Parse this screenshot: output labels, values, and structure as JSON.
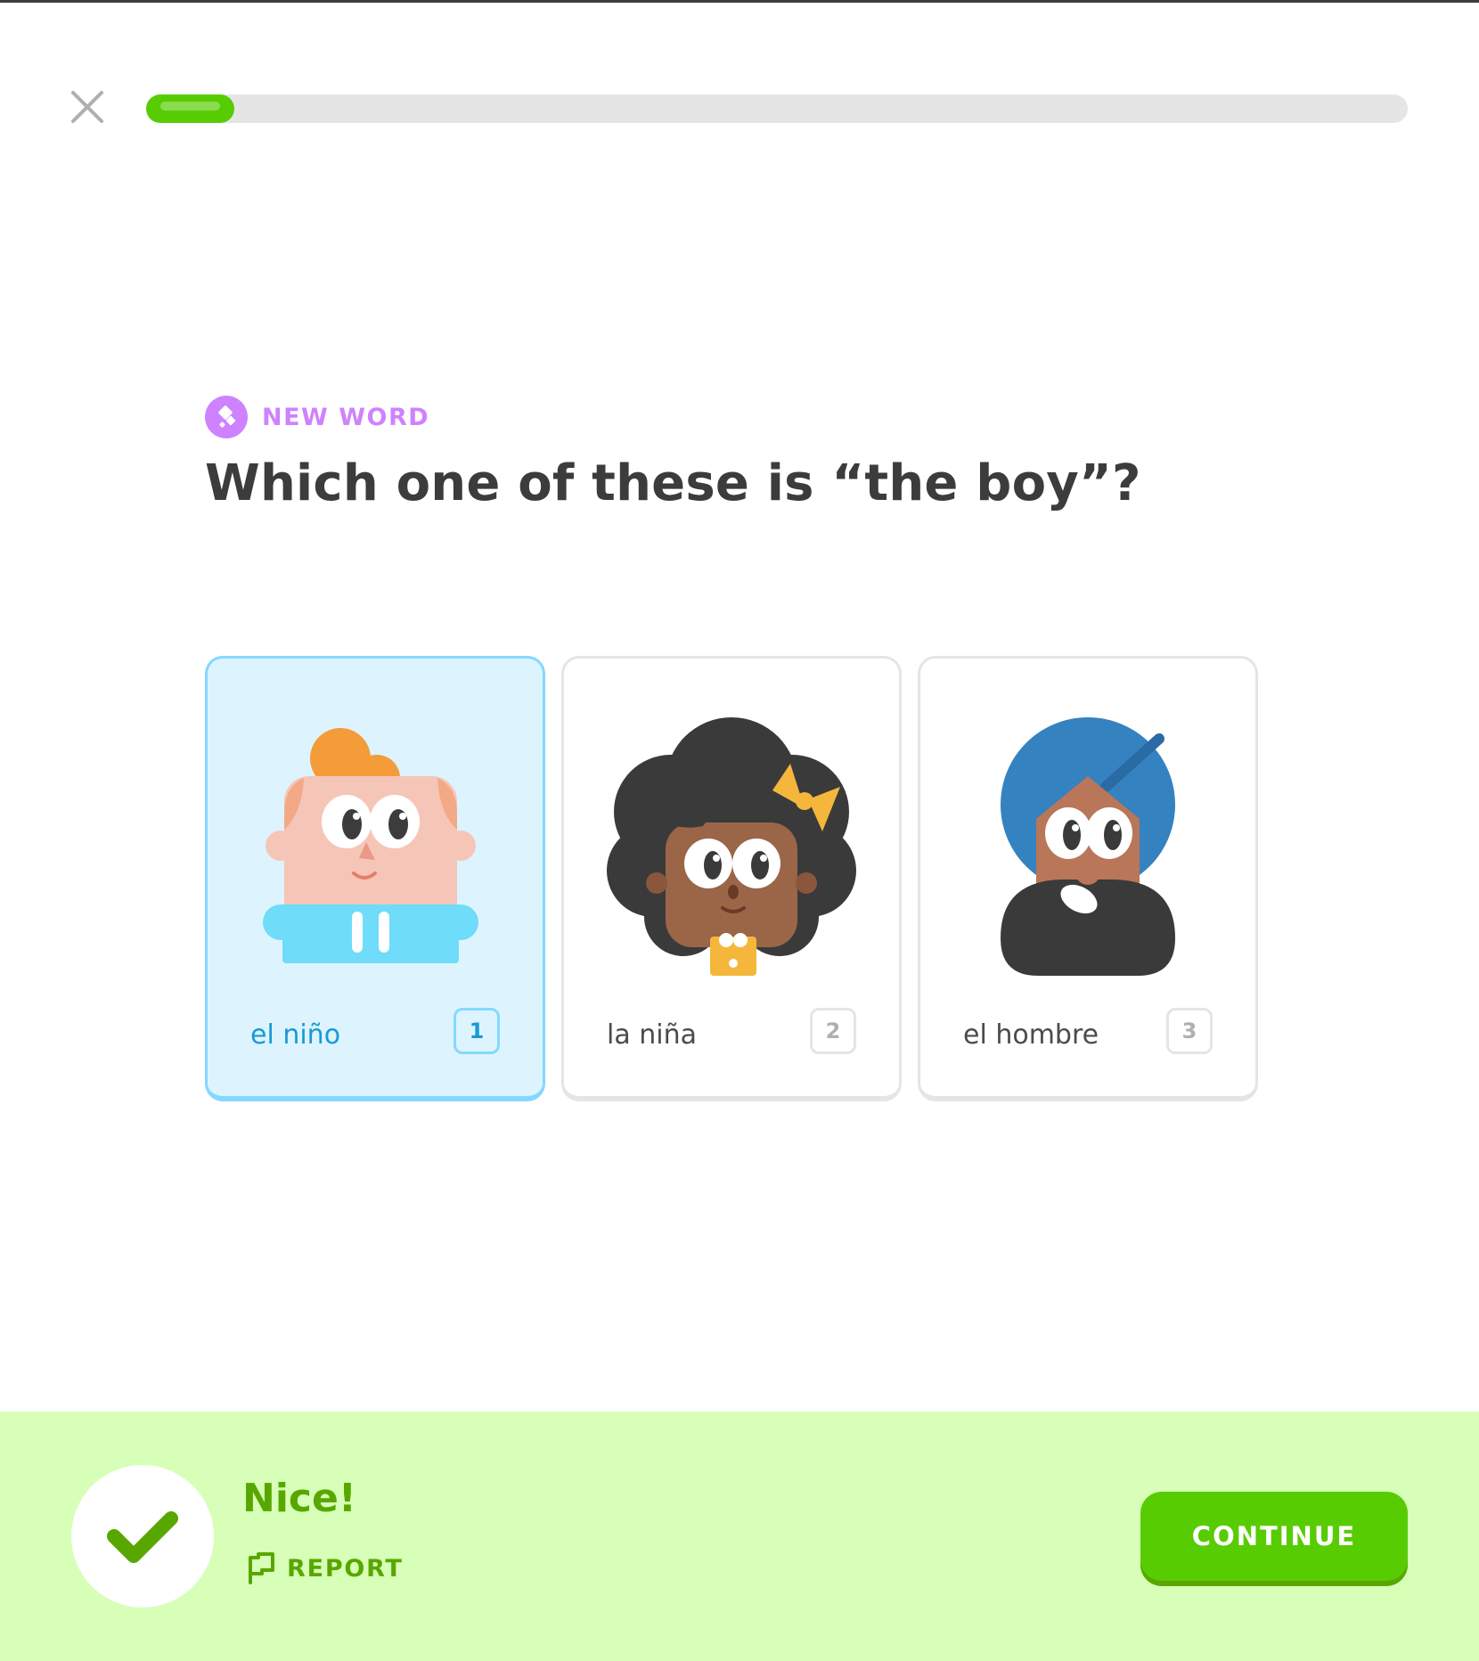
{
  "header": {
    "close_icon": "close-icon",
    "progress": 0.07
  },
  "challenge": {
    "badge_icon": "new-word-icon",
    "badge_label": "NEW WORD",
    "question": "Which one of these is “the boy”?"
  },
  "choices": [
    {
      "label": "el niño",
      "key": "1",
      "selected": true,
      "art": "boy-character"
    },
    {
      "label": "la niña",
      "key": "2",
      "selected": false,
      "art": "girl-character"
    },
    {
      "label": "el hombre",
      "key": "3",
      "selected": false,
      "art": "man-character"
    }
  ],
  "footer": {
    "status": "correct",
    "title": "Nice!",
    "report_label": "REPORT",
    "continue_label": "CONTINUE"
  },
  "colors": {
    "brand_green": "#58cc02",
    "footer_bg": "#d7ffb8",
    "selected_blue": "#1899d6",
    "badge_purple": "#ce82ff"
  }
}
